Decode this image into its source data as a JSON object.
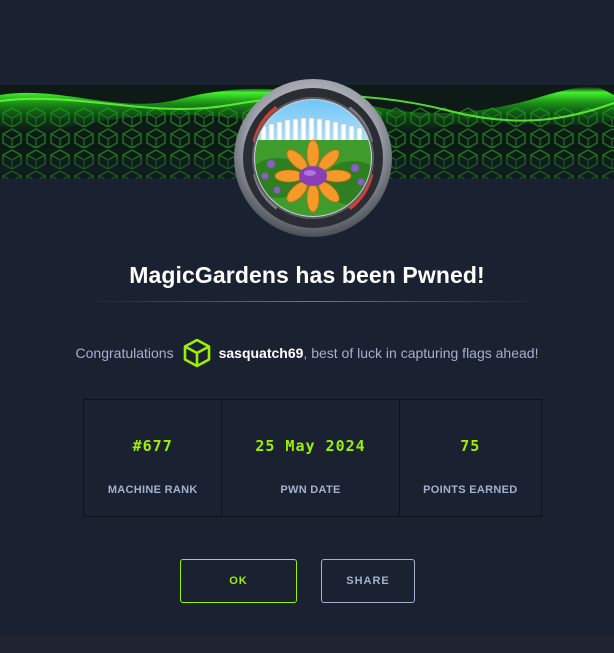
{
  "modal": {
    "title": "MagicGardens has been Pwned!",
    "congrats_prefix": "Congratulations",
    "username": "sasquatch69",
    "congrats_suffix": ", best of luck in capturing flags ahead!",
    "machine_avatar_icon": "magicgardens-machine-avatar",
    "user_icon": "cube-icon"
  },
  "stats": [
    {
      "value": "#677",
      "label": "MACHINE RANK"
    },
    {
      "value": "25 May 2024",
      "label": "PWN DATE"
    },
    {
      "value": "75",
      "label": "POINTS EARNED"
    }
  ],
  "buttons": {
    "ok": "OK",
    "share": "SHARE"
  },
  "colors": {
    "accent": "#9fef00",
    "background": "#1a2130",
    "muted_text": "#a4b1cd"
  }
}
